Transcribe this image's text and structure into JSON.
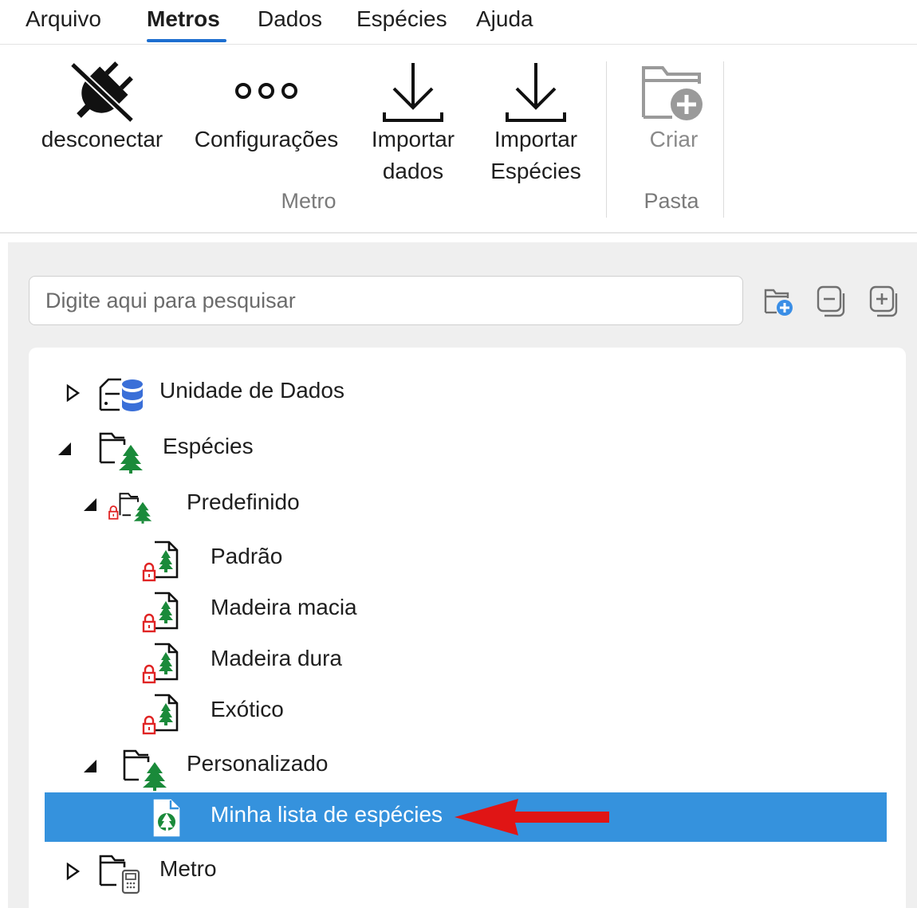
{
  "menu": {
    "items": [
      {
        "label": "Arquivo"
      },
      {
        "label": "Metros"
      },
      {
        "label": "Dados"
      },
      {
        "label": "Espécies"
      },
      {
        "label": "Ajuda"
      }
    ],
    "active_index": 1
  },
  "ribbon": {
    "disconnect": {
      "label": "desconectar",
      "icon": "disconnect-icon"
    },
    "settings": {
      "label": "Configurações",
      "icon": "more-dots-icon"
    },
    "import_data": {
      "label_line1": "Importar",
      "label_line2": "dados",
      "icon": "download-icon"
    },
    "import_species": {
      "label_line1": "Importar",
      "label_line2": "Espécies",
      "icon": "download-icon"
    },
    "create": {
      "label": "Criar",
      "icon": "folder-add-icon",
      "disabled": true
    },
    "groups": {
      "meter": "Metro",
      "folder": "Pasta"
    }
  },
  "panel": {
    "search": {
      "placeholder": "Digite aqui para pesquisar",
      "value": ""
    },
    "tools": [
      "new-folder-icon",
      "collapse-all-icon",
      "expand-all-icon"
    ]
  },
  "tree": {
    "data_unit": "Unidade de Dados",
    "species": "Espécies",
    "predefined": "Predefinido",
    "default": "Padrão",
    "softwood": "Madeira macia",
    "hardwood": "Madeira dura",
    "exotic": "Exótico",
    "custom": "Personalizado",
    "my_list": "Minha lista de espécies",
    "meter": "Metro",
    "selected_item": "Minha lista de espécies"
  },
  "colors": {
    "accent": "#1e6fd0",
    "selection": "#3592dd",
    "tree_green": "#1a8a3a",
    "lock_red": "#e02424",
    "db_blue": "#3a6fd8",
    "annotation_arrow": "#e01515"
  }
}
